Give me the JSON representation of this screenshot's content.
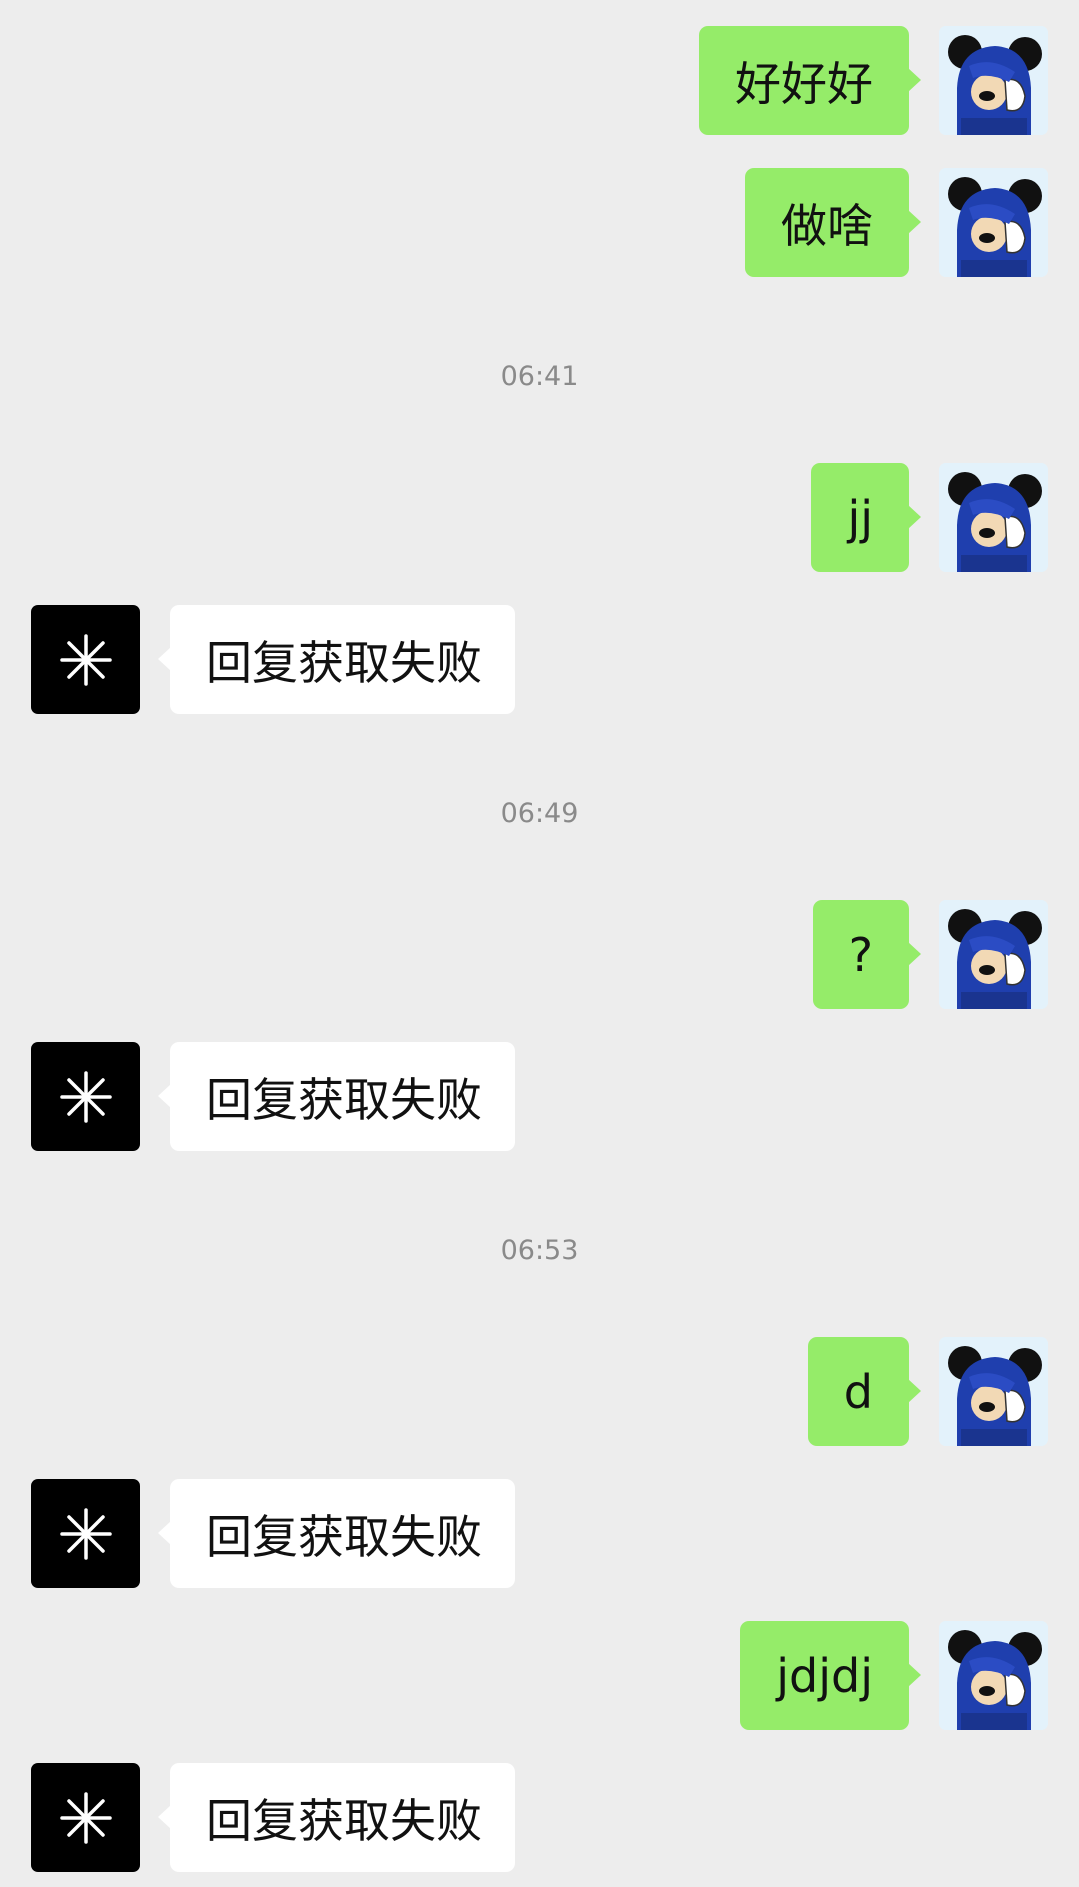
{
  "chat": {
    "messages": [
      {
        "type": "sent",
        "text": "好好好"
      },
      {
        "type": "sent",
        "text": "做啥"
      },
      {
        "type": "time",
        "text": "06:41"
      },
      {
        "type": "sent",
        "text": "jj"
      },
      {
        "type": "received",
        "text": "回复获取失败"
      },
      {
        "type": "time",
        "text": "06:49"
      },
      {
        "type": "sent",
        "text": "?"
      },
      {
        "type": "received",
        "text": "回复获取失败"
      },
      {
        "type": "time",
        "text": "06:53"
      },
      {
        "type": "sent",
        "text": "d"
      },
      {
        "type": "received",
        "text": "回复获取失败"
      },
      {
        "type": "sent",
        "text": "jdjdj"
      },
      {
        "type": "received",
        "text": "回复获取失败"
      }
    ]
  },
  "avatars": {
    "user_icon": "mickey-hoodie-avatar-icon",
    "bot_icon": "asterisk-logo-icon"
  },
  "colors": {
    "background": "#ededed",
    "sent_bubble": "#95ec69",
    "received_bubble": "#ffffff",
    "bot_avatar": "#000000",
    "timestamp_text": "#8a8a8a"
  }
}
